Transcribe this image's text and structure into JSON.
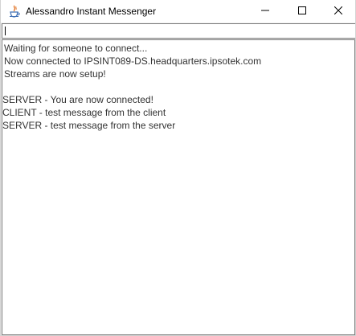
{
  "window": {
    "title": "Alessandro Instant Messenger",
    "icon": "java-cup-icon",
    "controls": {
      "minimize": "minimize-icon",
      "maximize": "maximize-icon",
      "close": "close-icon"
    }
  },
  "message_input": {
    "value": "",
    "placeholder": ""
  },
  "chat": {
    "lines": [
      "Waiting for someone to connect...",
      "Now connected to IPSINT089-DS.headquarters.ipsotek.com",
      "Streams are now setup!",
      "SERVER -  You are now connected!",
      "CLIENT - test message from the client",
      "SERVER - test message from the server"
    ]
  },
  "colors": {
    "titlebar": "#ffffff",
    "chat_background": "#ffffff",
    "chat_text": "#333333",
    "border": "#7a7a7a"
  }
}
